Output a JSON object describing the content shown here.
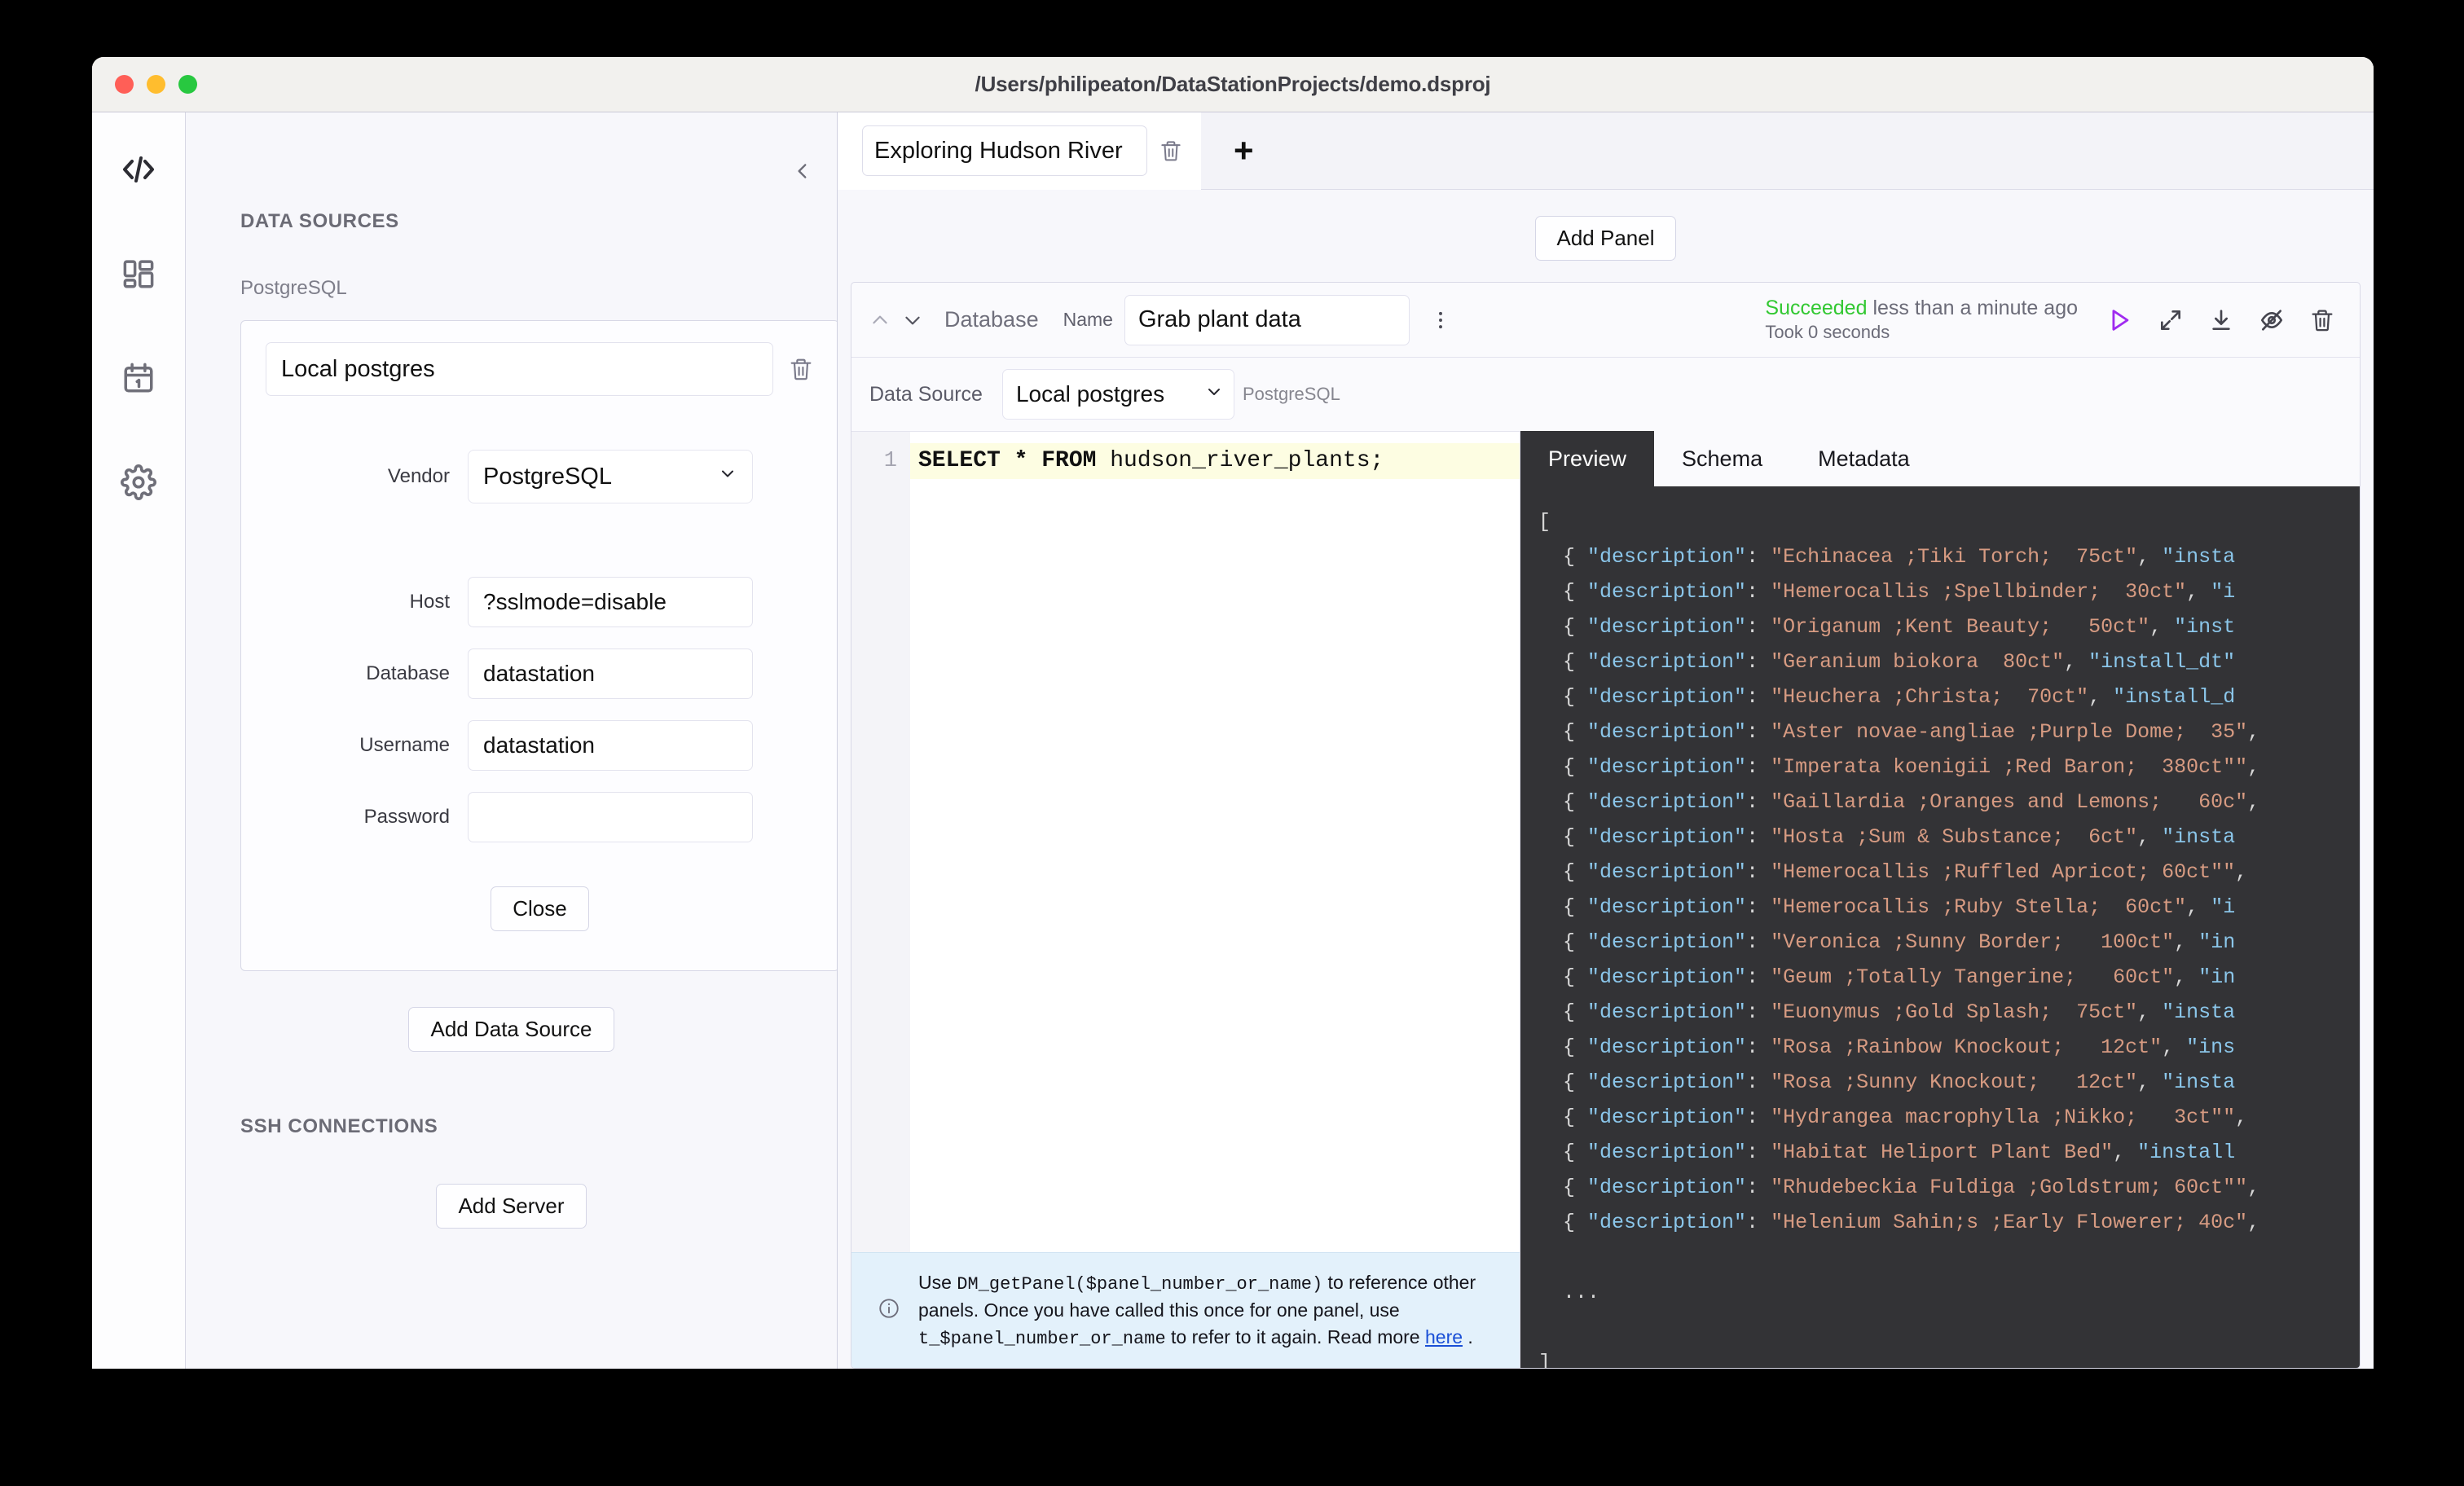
{
  "window": {
    "title": "/Users/philipeaton/DataStationProjects/demo.dsproj"
  },
  "rail": {
    "items": [
      {
        "name": "code-icon",
        "label": "Code"
      },
      {
        "name": "dashboard-icon",
        "label": "Dashboard"
      },
      {
        "name": "schedule-icon",
        "label": "Schedule"
      },
      {
        "name": "settings-icon",
        "label": "Settings"
      }
    ]
  },
  "data_sources": {
    "heading": "DATA SOURCES",
    "vendor_group": "PostgreSQL",
    "connection": {
      "name": "Local postgres",
      "vendor_label": "Vendor",
      "vendor_value": "PostgreSQL",
      "fields": [
        {
          "label": "Host",
          "value": "?sslmode=disable",
          "placeholder": ""
        },
        {
          "label": "Database",
          "value": "datastation",
          "placeholder": ""
        },
        {
          "label": "Username",
          "value": "datastation",
          "placeholder": ""
        },
        {
          "label": "Password",
          "value": "",
          "placeholder": ""
        }
      ],
      "close_label": "Close"
    },
    "add_data_source_label": "Add Data Source",
    "ssh_heading": "SSH CONNECTIONS",
    "add_server_label": "Add Server"
  },
  "tabs": {
    "active_name": "Exploring Hudson River",
    "add_tab_glyph": "+"
  },
  "toolbar": {
    "add_panel_label": "Add Panel"
  },
  "panel": {
    "type_label": "Database",
    "name_label": "Name",
    "name_value": "Grab plant data",
    "status_state": "Succeeded",
    "status_when": " less than a minute ago",
    "status_took": "Took 0 seconds",
    "status_color": "#32c832",
    "run_color": "#a02bf0",
    "datasource_label": "Data Source",
    "datasource_value": "Local postgres",
    "datasource_vendor": "PostgreSQL",
    "actions": [
      {
        "name": "run-panel-button",
        "label": "Run"
      },
      {
        "name": "fullscreen-button",
        "label": "Fullscreen"
      },
      {
        "name": "download-button",
        "label": "Download"
      },
      {
        "name": "hide-panel-button",
        "label": "Hide"
      },
      {
        "name": "delete-panel-button",
        "label": "Delete"
      }
    ]
  },
  "editor": {
    "line_number": "1",
    "sql_keyword1": "SELECT * FROM ",
    "sql_table": "hudson_river_plants;"
  },
  "info": {
    "prefix": "Use ",
    "code1": "DM_getPanel($panel_number_or_name)",
    "mid": " to reference other panels. Once you have called this once for one panel, use ",
    "code2": "t_$panel_number_or_name",
    "suffix": " to refer to it again. Read more ",
    "link": "here",
    "period": " ."
  },
  "results": {
    "tabs": [
      {
        "label": "Preview",
        "active": true
      },
      {
        "label": "Schema",
        "active": false
      },
      {
        "label": "Metadata",
        "active": false
      }
    ],
    "open_bracket": "[",
    "close_bracket": "]",
    "ellipsis": "...",
    "key": "description",
    "rows": [
      {
        "description": "Echinacea ;Tiki Torch;  75ct",
        "tail": "\"insta"
      },
      {
        "description": "Hemerocallis ;Spellbinder;  30ct",
        "tail": "\"i"
      },
      {
        "description": "Origanum ;Kent Beauty;   50ct",
        "tail": "\"inst"
      },
      {
        "description": "Geranium biokora  80ct",
        "tail": "\"install_dt\""
      },
      {
        "description": "Heuchera ;Christa;  70ct",
        "tail": "\"install_d"
      },
      {
        "description": "Aster novae-angliae ;Purple Dome;  35",
        "tail": ""
      },
      {
        "description": "Imperata koenigii ;Red Baron;  380ct\"",
        "tail": ""
      },
      {
        "description": "Gaillardia ;Oranges and Lemons;   60c",
        "tail": ""
      },
      {
        "description": "Hosta ;Sum & Substance;  6ct",
        "tail": "\"insta"
      },
      {
        "description": "Hemerocallis ;Ruffled Apricot; 60ct\"",
        "tail": ""
      },
      {
        "description": "Hemerocallis ;Ruby Stella;  60ct",
        "tail": "\"i"
      },
      {
        "description": "Veronica ;Sunny Border;   100ct",
        "tail": "\"in"
      },
      {
        "description": "Geum ;Totally Tangerine;   60ct",
        "tail": "\"in"
      },
      {
        "description": "Euonymus ;Gold Splash;  75ct",
        "tail": "\"insta"
      },
      {
        "description": "Rosa ;Rainbow Knockout;   12ct",
        "tail": "\"ins"
      },
      {
        "description": "Rosa ;Sunny Knockout;   12ct",
        "tail": "\"insta"
      },
      {
        "description": "Hydrangea macrophylla ;Nikko;   3ct\"",
        "tail": ""
      },
      {
        "description": "Habitat Heliport Plant Bed",
        "tail": "\"install"
      },
      {
        "description": "Rhudebeckia Fuldiga ;Goldstrum; 60ct\"",
        "tail": ""
      },
      {
        "description": "Helenium Sahin;s ;Early Flowerer; 40c",
        "tail": ""
      }
    ]
  }
}
